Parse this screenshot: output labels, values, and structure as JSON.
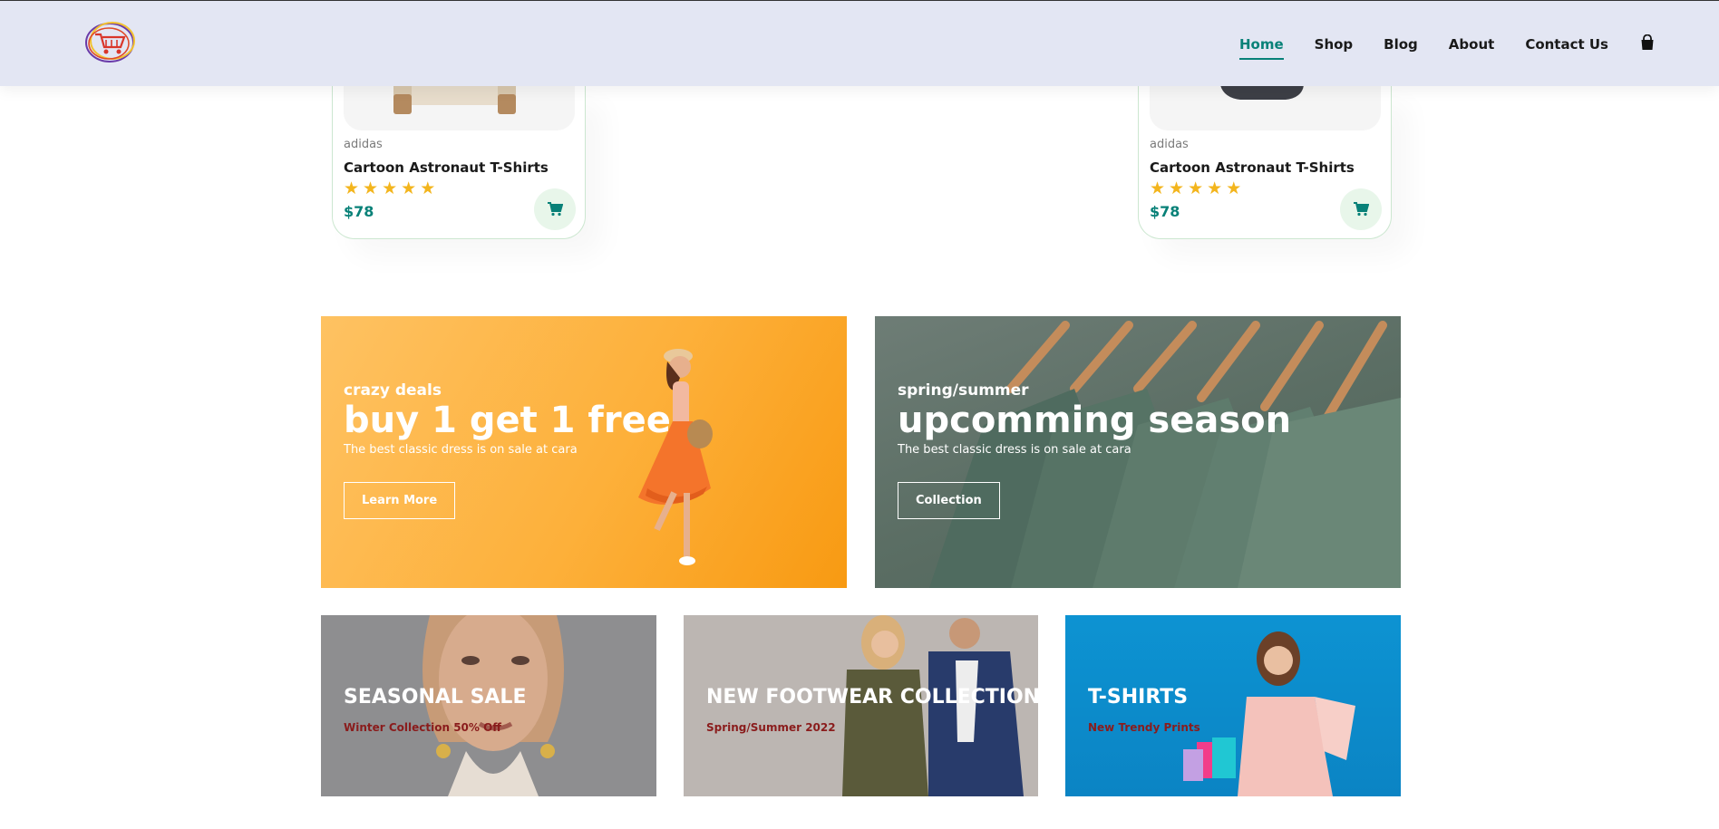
{
  "nav": {
    "items": [
      {
        "label": "Home",
        "active": true
      },
      {
        "label": "Shop",
        "active": false
      },
      {
        "label": "Blog",
        "active": false
      },
      {
        "label": "About",
        "active": false
      },
      {
        "label": "Contact Us",
        "active": false
      }
    ],
    "cart_icon": "shopping-bag-icon"
  },
  "products": [
    {
      "brand": "adidas",
      "name": "Cartoon Astronaut T-Shirts",
      "rating": 5,
      "price": "$78"
    },
    {
      "brand": "adidas",
      "name": "Cartoon Astronaut T-Shirts",
      "rating": 5,
      "price": "$78"
    }
  ],
  "banners": {
    "deals": {
      "kicker": "crazy deals",
      "headline": "buy 1 get 1 free",
      "subtitle": "The best classic dress is on sale at cara",
      "button": "Learn More",
      "bg": "#fdb03a"
    },
    "season": {
      "kicker": "spring/summer",
      "headline": "upcomming season",
      "subtitle": "The best classic dress is on sale at cara",
      "button": "Collection",
      "bg": "#5f7268"
    }
  },
  "small_banners": [
    {
      "title": "SEASONAL SALE",
      "subtitle": "Winter Collection 50% Off",
      "bg": "#8e8e90"
    },
    {
      "title": "NEW FOOTWEAR COLLECTION",
      "subtitle": "Spring/Summer 2022",
      "bg": "#bcb6b2"
    },
    {
      "title": "T-SHIRTS",
      "subtitle": "New Trendy Prints",
      "bg": "#0f8ccc"
    }
  ],
  "colors": {
    "accent": "#088178",
    "star": "#f3b51d",
    "header_bg": "#e3e6f3"
  }
}
